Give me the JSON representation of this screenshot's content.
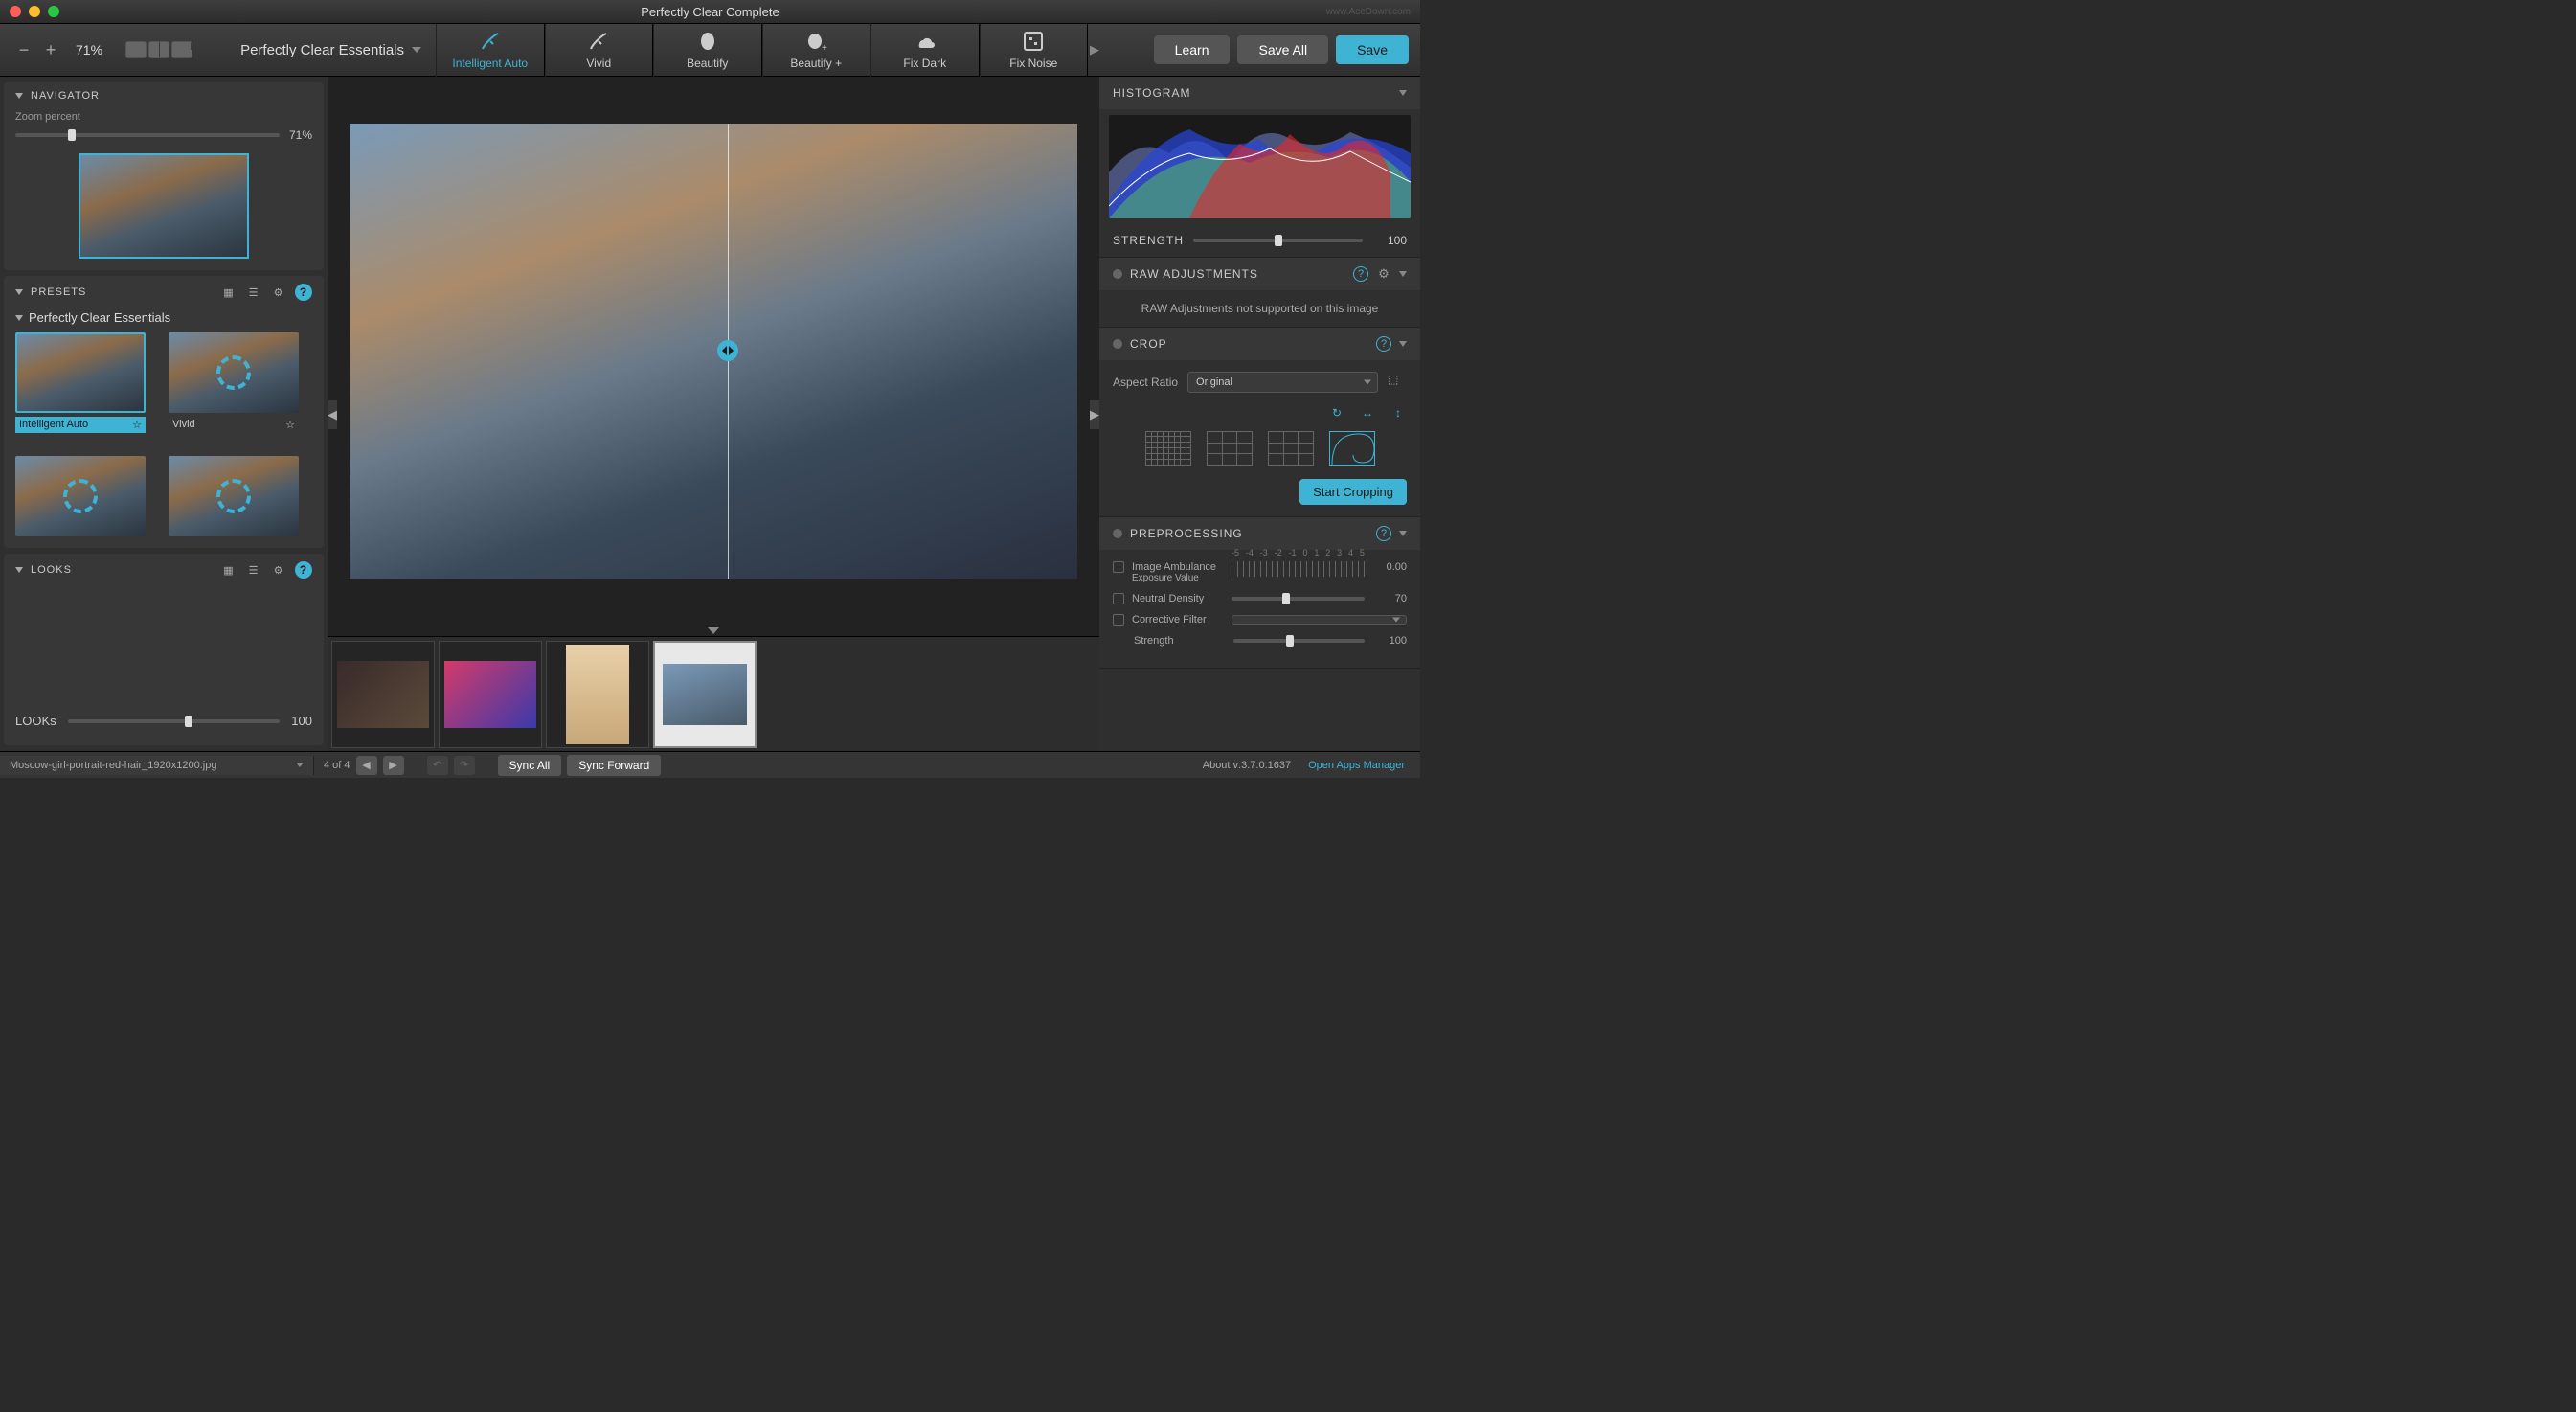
{
  "window": {
    "title": "Perfectly Clear Complete",
    "watermark": "www.AceDown.com"
  },
  "toolbar": {
    "zoom_label": "71%",
    "preset_dropdown": "Perfectly Clear Essentials",
    "tabs": [
      {
        "label": "Intelligent Auto"
      },
      {
        "label": "Vivid"
      },
      {
        "label": "Beautify"
      },
      {
        "label": "Beautify +"
      },
      {
        "label": "Fix Dark"
      },
      {
        "label": "Fix Noise"
      }
    ],
    "learn": "Learn",
    "save_all": "Save All",
    "save": "Save"
  },
  "navigator": {
    "title": "NAVIGATOR",
    "zoom_label": "Zoom percent",
    "zoom_value": "71%"
  },
  "presets": {
    "title": "PRESETS",
    "group": "Perfectly Clear Essentials",
    "items": [
      {
        "name": "Intelligent Auto",
        "star": "☆"
      },
      {
        "name": "Vivid",
        "star": "☆"
      }
    ]
  },
  "looks": {
    "title": "LOOKS",
    "slider_label": "LOOKs",
    "slider_value": "100"
  },
  "histogram": {
    "title": "HISTOGRAM"
  },
  "strength": {
    "label": "STRENGTH",
    "value": "100"
  },
  "raw": {
    "title": "RAW ADJUSTMENTS",
    "message": "RAW Adjustments not supported on this image"
  },
  "crop": {
    "title": "CROP",
    "aspect_label": "Aspect Ratio",
    "aspect_value": "Original",
    "start_button": "Start Cropping"
  },
  "preprocessing": {
    "title": "PREPROCESSING",
    "ambulance_label": "Image Ambulance",
    "ambulance_sublabel": "Exposure Value",
    "ambulance_value": "0.00",
    "nd_label": "Neutral Density",
    "nd_value": "70",
    "cf_label": "Corrective Filter",
    "strength_label": "Strength",
    "strength_value": "100",
    "tick_labels": [
      "-5",
      "-4",
      "-3",
      "-2",
      "-1",
      "0",
      "1",
      "2",
      "3",
      "4",
      "5"
    ]
  },
  "footer": {
    "filename": "Moscow-girl-portrait-red-hair_1920x1200.jpg",
    "counter": "4 of 4",
    "sync_all": "Sync All",
    "sync_forward": "Sync Forward",
    "about": "About v:3.7.0.1637",
    "open_manager": "Open Apps Manager"
  }
}
